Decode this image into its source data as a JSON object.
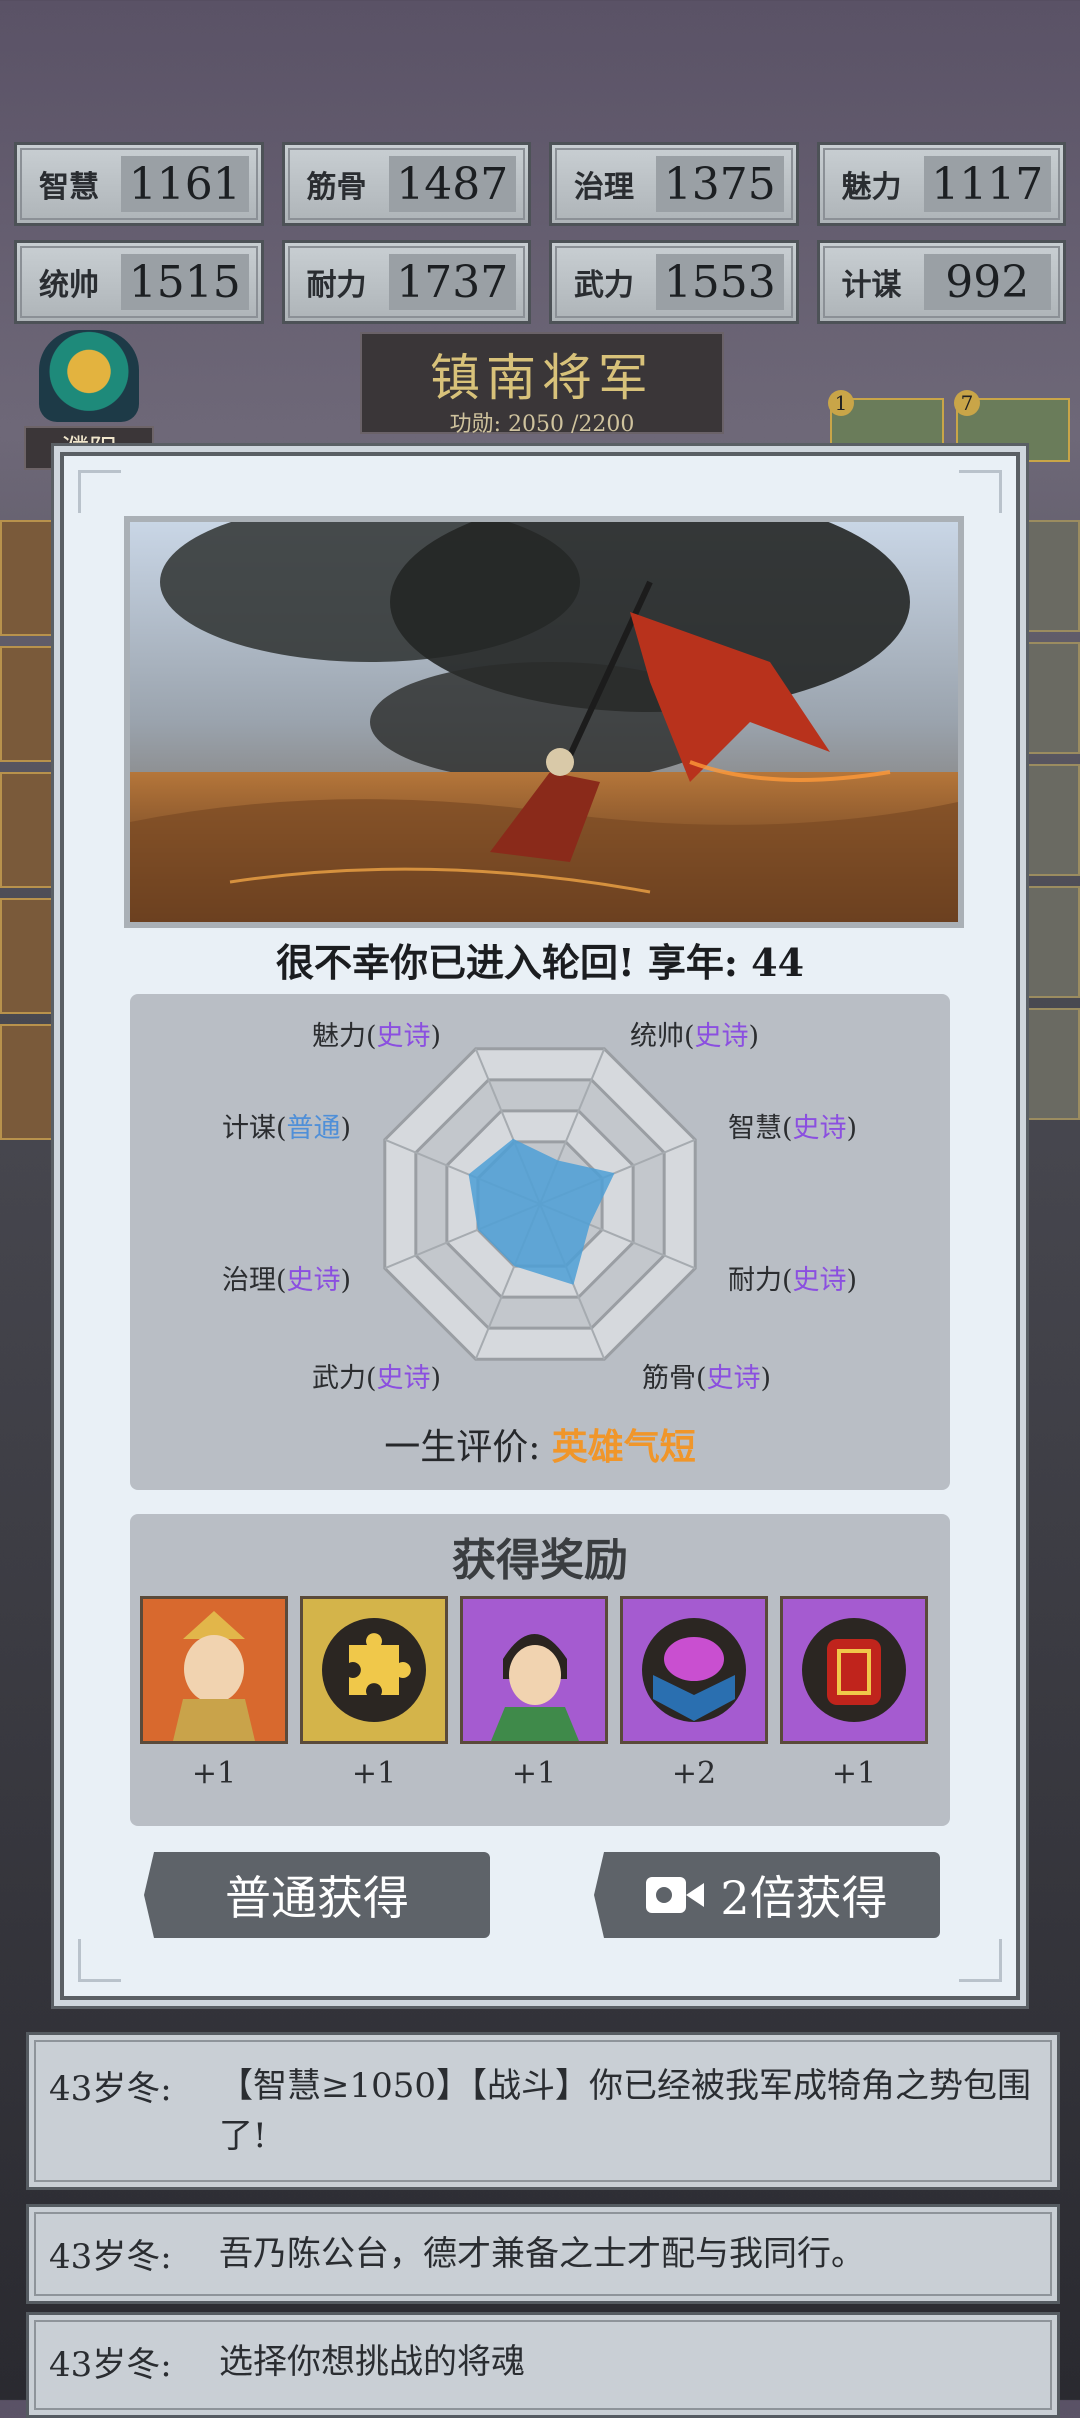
{
  "stats": [
    {
      "label": "智慧",
      "value": "1161"
    },
    {
      "label": "筋骨",
      "value": "1487"
    },
    {
      "label": "治理",
      "value": "1375"
    },
    {
      "label": "魅力",
      "value": "1117"
    },
    {
      "label": "统帅",
      "value": "1515"
    },
    {
      "label": "耐力",
      "value": "1737"
    },
    {
      "label": "武力",
      "value": "1553"
    },
    {
      "label": "计谋",
      "value": "992"
    }
  ],
  "rank": {
    "title": "镇南将军",
    "merit": "功勋: 2050 /2200"
  },
  "city": {
    "name": "濮阳"
  },
  "top_badges": [
    "1",
    "7"
  ],
  "modal": {
    "fate_text": "很不幸你已进入轮回! 享年: 44",
    "radar_labels": [
      {
        "name": "魅力",
        "grade": "史诗"
      },
      {
        "name": "统帅",
        "grade": "史诗"
      },
      {
        "name": "计谋",
        "grade": "普通"
      },
      {
        "name": "智慧",
        "grade": "史诗"
      },
      {
        "name": "治理",
        "grade": "史诗"
      },
      {
        "name": "耐力",
        "grade": "史诗"
      },
      {
        "name": "武力",
        "grade": "史诗"
      },
      {
        "name": "筋骨",
        "grade": "史诗"
      }
    ],
    "radar_values": [
      0.42,
      0.28,
      0.48,
      0.32,
      0.52,
      0.4,
      0.4,
      0.46
    ],
    "verdict_label": "一生评价:",
    "verdict_value": "英雄气短",
    "reward_title": "获得奖励",
    "rewards": [
      {
        "icon": "general-portrait-icon",
        "count": "+1"
      },
      {
        "icon": "puzzle-piece-icon",
        "count": "+1"
      },
      {
        "icon": "young-hero-portrait-icon",
        "count": "+1"
      },
      {
        "icon": "treasure-chest-icon",
        "count": "+2"
      },
      {
        "icon": "red-lantern-icon",
        "count": "+1"
      }
    ],
    "btn_normal": "普通获得",
    "btn_double": "2倍获得"
  },
  "log": [
    {
      "age": "43岁冬:",
      "text": "【智慧≥1050】【战斗】你已经被我军成犄角之势包围了!"
    },
    {
      "age": "43岁冬:",
      "text": "吾乃陈公台，德才兼备之士才配与我同行。"
    },
    {
      "age": "43岁冬:",
      "text": "选择你想挑战的将魂"
    }
  ],
  "colors": {
    "epic": "#8b4fe0",
    "normal": "#4f8fd8",
    "verdict": "#f0962a",
    "radar_fill": "#4e9fd6"
  }
}
